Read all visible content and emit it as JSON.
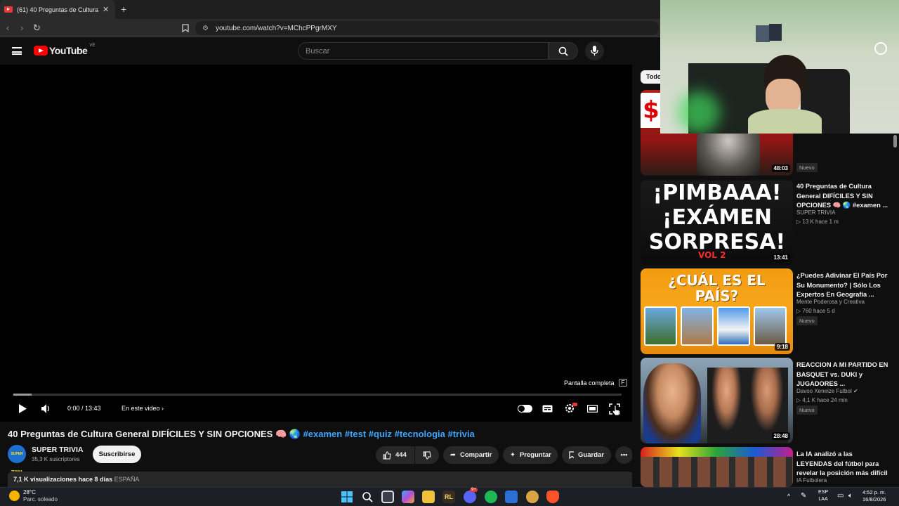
{
  "browser": {
    "tab_title": "(61) 40 Preguntas de Cultura General DIFÍCILES Y SIN OPCIONES",
    "url": "youtube.com/watch?v=MChcPPgrMXY"
  },
  "youtube": {
    "logo_text": "YouTube",
    "country_code": "VE",
    "search_placeholder": "Buscar"
  },
  "player": {
    "fullscreen_tooltip": "Pantalla completa",
    "fullscreen_key": "F",
    "time": "0:00 / 13:43",
    "chapter_label": "En este video",
    "progress_fraction": 0.03
  },
  "video": {
    "title": "40 Preguntas de Cultura General DIFÍCILES Y SIN OPCIONES 🧠 🌏",
    "hashtags": "#examen #test #quiz #tecnologia #trivia",
    "channel_avatar_text": "SUPER TRIVIA",
    "channel": "SUPER TRIVIA",
    "subscribers": "35,3 K suscriptores",
    "subscribe_label": "Suscribirse",
    "likes": "444",
    "share_label": "Compartir",
    "ask_label": "Preguntar",
    "save_label": "Guardar",
    "views_date": "7,1 K visualizaciones  hace 8 días",
    "country": "ESPAÑA"
  },
  "sidebar": {
    "chip_all": "Todo",
    "recommendations": [
      {
        "title": "",
        "channel": "",
        "meta": "",
        "badge": "Nuevo",
        "duration": "48:03",
        "thumb_text": ""
      },
      {
        "title": "40 Preguntas de Cultura General DIFÍCILES Y SIN OPCIONES 🧠 🌏 #examen ...",
        "channel": "SUPER TRIVIA",
        "meta": "▷ 13 K  hace 1 m",
        "badge": "",
        "duration": "13:41",
        "thumb_text": "¡PIMBAAA! ¡EXÁMEN SORPRESA!",
        "thumb_sub": "VOL 2"
      },
      {
        "title": "¿Puedes Adivinar El País Por Su Monumento? | Sólo Los Expertos En Geografía ...",
        "channel": "Mente Poderosa y Creativa",
        "meta": "▷ 760  hace 5 d",
        "badge": "Nuevo",
        "duration": "9:18",
        "thumb_text": "¿CUÁL ES EL PAÍS?"
      },
      {
        "title": "REACCION A MI PARTIDO EN BASQUET vs. DUKI y JUGADORES ...",
        "channel": "Davoo Xeneize Futbol ✔",
        "meta": "▷ 4,1 K  hace 24 min",
        "badge": "Nuevo",
        "duration": "28:48",
        "thumb_text": ""
      },
      {
        "title": "La IA analizó a las LEYENDAS del fútbol para revelar la posición más difícil",
        "channel": "IA Futbolera",
        "meta": "",
        "badge": "",
        "duration": "",
        "thumb_text": ""
      }
    ]
  },
  "taskbar": {
    "temperature": "28°C",
    "weather": "Parc. soleado",
    "lang_top": "ESP",
    "lang_bottom": "LAA",
    "time": "4:52 p. m.",
    "date": "16/8/2026",
    "discord_badge": "9+"
  },
  "colors": {
    "youtube_red": "#ff0000",
    "link_blue": "#3ea6ff",
    "background": "#0f0f0f"
  }
}
